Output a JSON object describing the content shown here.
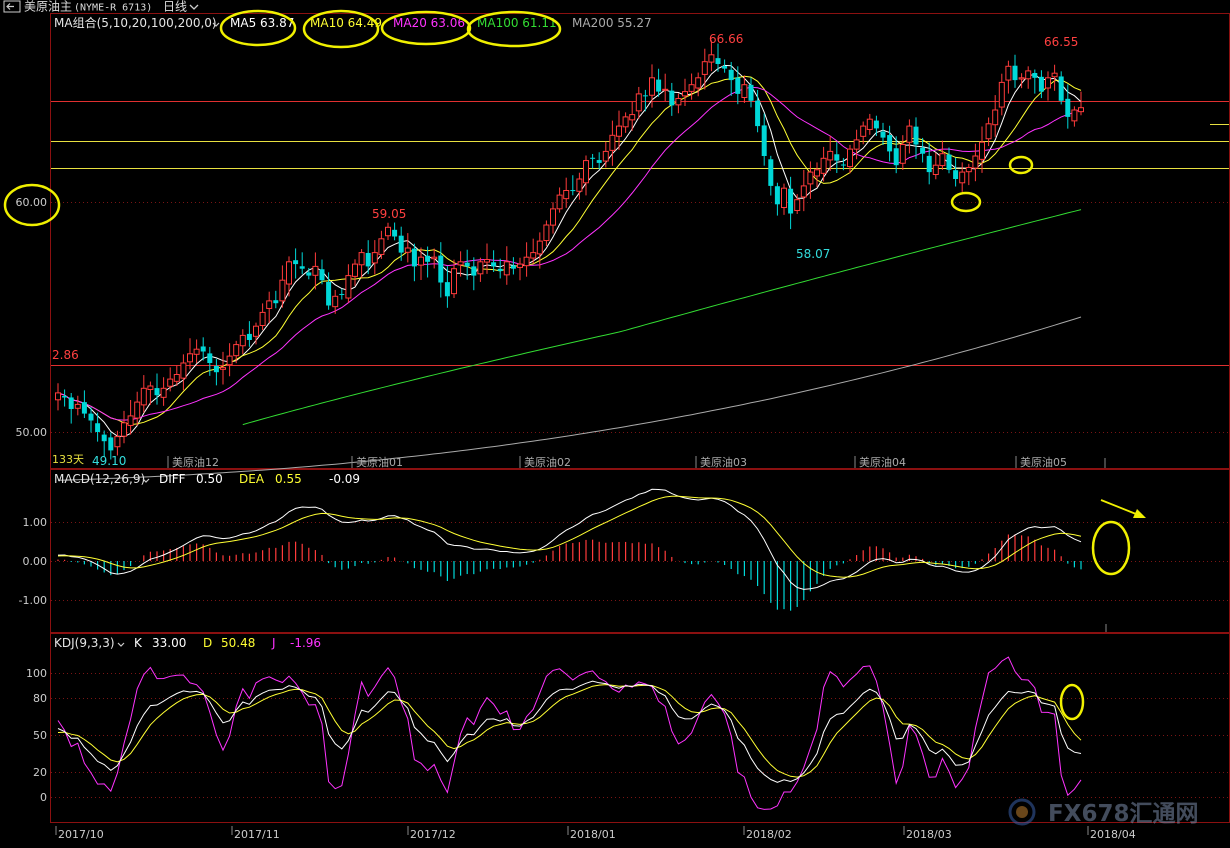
{
  "window": {
    "icon": "back-arrow-icon",
    "title": "美原油主",
    "code": "(NYME-R 6713)",
    "period": "日线"
  },
  "price": {
    "ma_group": "MA组合(5,10,20,100,200,0)",
    "ma": [
      {
        "label": "MA5 63.87",
        "color": "#ffffff"
      },
      {
        "label": "MA10 64.49",
        "color": "#ffff33"
      },
      {
        "label": "MA20 63.06",
        "color": "#ff33ff"
      },
      {
        "label": "MA100 61.11",
        "color": "#33dd33"
      },
      {
        "label": "MA200 55.27",
        "color": "#aaaaaa"
      }
    ],
    "y_labels": [
      "60.00",
      "50.00"
    ],
    "annotations": [
      "66.66",
      "66.55",
      "59.05",
      "58.07",
      "2.86",
      "49.10"
    ],
    "days_label": "133天",
    "contract_labels": [
      "美原油12",
      "美原油01",
      "美原油02",
      "美原油03",
      "美原油04",
      "美原油05"
    ]
  },
  "macd": {
    "title": "MACD(12,26,9)",
    "diff_label": "DIFF",
    "diff": "0.50",
    "dea_label": "DEA",
    "dea": "0.55",
    "macd": "-0.09",
    "y_labels": [
      "1.00",
      "0.00",
      "-1.00"
    ]
  },
  "kdj": {
    "title": "KDJ(9,3,3)",
    "k_label": "K",
    "k": "33.00",
    "d_label": "D",
    "d": "50.48",
    "j_label": "J",
    "j": "-1.96",
    "y_labels": [
      "100",
      "80",
      "50",
      "20",
      "0"
    ]
  },
  "x_axis": {
    "labels": [
      "2017/10",
      "2017/11",
      "2017/12",
      "2018/01",
      "2018/02",
      "2018/03",
      "2018/04"
    ]
  },
  "watermark": {
    "icon": "fx678-logo-icon",
    "text": "FX678汇通网"
  },
  "chart_data": [
    {
      "type": "candlestick",
      "ylim": [
        47.5,
        68.8
      ],
      "close": [
        51.7,
        51.5,
        51.0,
        51.2,
        50.8,
        50.5,
        50.0,
        49.6,
        49.2,
        49.8,
        50.4,
        50.7,
        51.3,
        51.9,
        52.0,
        51.6,
        51.9,
        52.3,
        52.5,
        53.0,
        53.4,
        53.6,
        53.5,
        53.0,
        52.6,
        52.8,
        53.3,
        53.8,
        54.2,
        54.0,
        54.6,
        55.2,
        55.7,
        55.6,
        56.6,
        57.4,
        57.3,
        57.1,
        56.8,
        57.2,
        56.6,
        55.5,
        55.9,
        56.0,
        56.8,
        57.3,
        57.8,
        57.2,
        57.8,
        58.4,
        58.9,
        58.5,
        57.8,
        58.0,
        57.2,
        57.6,
        57.4,
        57.6,
        56.5,
        55.9,
        57.1,
        57.4,
        57.2,
        56.8,
        57.4,
        57.5,
        57.2,
        57.0,
        57.4,
        57.1,
        57.3,
        57.6,
        57.8,
        58.3,
        59.0,
        59.7,
        60.3,
        60.5,
        60.5,
        61.0,
        61.8,
        61.9,
        61.7,
        62.2,
        62.9,
        63.3,
        63.7,
        63.8,
        64.7,
        64.6,
        65.4,
        64.8,
        64.9,
        64.2,
        64.5,
        64.8,
        65.1,
        65.4,
        66.1,
        66.4,
        66.0,
        65.8,
        65.3,
        64.7,
        65.1,
        64.4,
        63.3,
        62.0,
        60.7,
        59.9,
        60.6,
        59.5,
        60.1,
        60.7,
        61.3,
        61.4,
        61.9,
        62.2,
        61.8,
        61.6,
        62.3,
        62.7,
        63.3,
        63.6,
        63.2,
        62.8,
        62.2,
        61.6,
        62.5,
        63.3,
        62.5,
        62.1,
        61.3,
        61.6,
        62.1,
        61.4,
        61.0,
        61.3,
        61.5,
        62.0,
        62.6,
        63.4,
        64.0,
        65.2,
        65.9,
        65.3,
        65.4,
        65.7,
        65.4,
        64.8,
        65.4,
        65.6,
        64.4,
        63.7,
        64.0,
        64.1
      ]
    },
    {
      "type": "line",
      "title": "MACD(12,26,9)",
      "series": [
        {
          "name": "DIFF"
        },
        {
          "name": "DEA"
        }
      ],
      "histogram_range": [
        -1.75,
        0.75
      ]
    },
    {
      "type": "line",
      "title": "KDJ(9,3,3)",
      "series": [
        {
          "name": "K"
        },
        {
          "name": "D"
        },
        {
          "name": "J"
        }
      ],
      "ylim": [
        -10,
        100
      ]
    }
  ]
}
